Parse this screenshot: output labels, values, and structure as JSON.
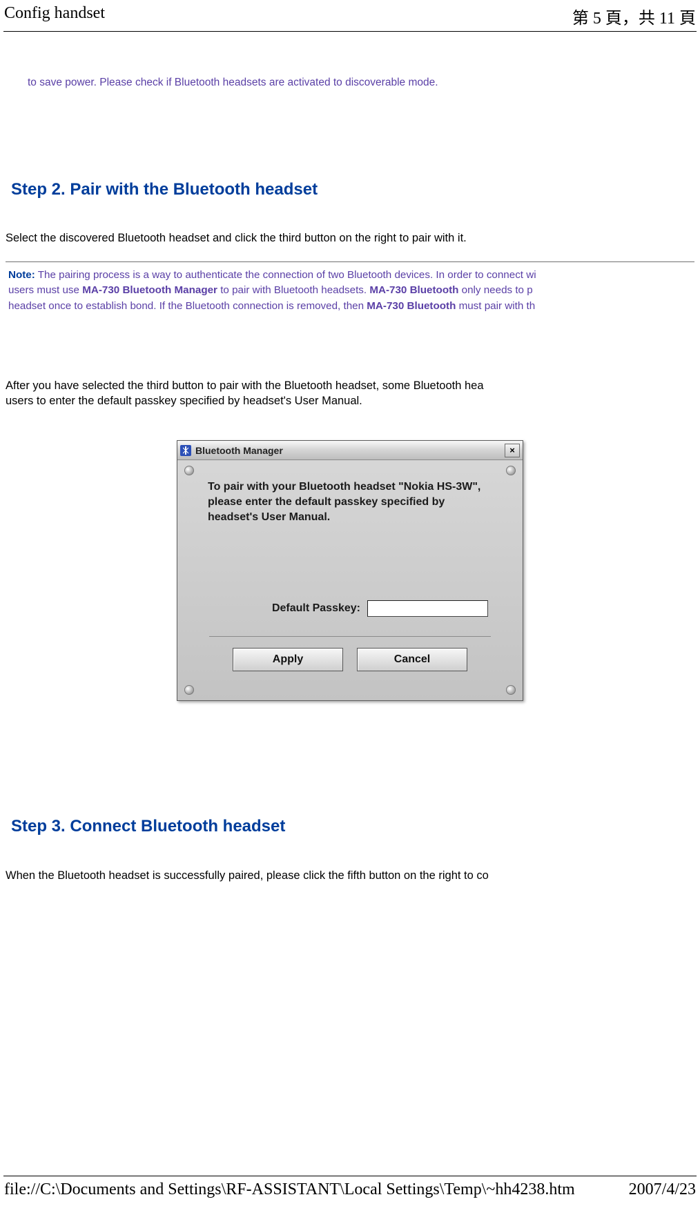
{
  "header": {
    "left": "Config handset",
    "right": "第 5 頁，共 11 頁"
  },
  "fragment_top": "to save power. Please check if Bluetooth headsets are activated to discoverable mode.",
  "step2": {
    "heading": "Step 2. Pair with the Bluetooth headset",
    "para1": "Select the discovered Bluetooth headset and click the third button on the right to pair with it.",
    "note_label": "Note:",
    "note_l1_a": " The pairing process is a way to authenticate the connection of two Bluetooth devices. In order to connect wi",
    "note_l2_a": "users must use ",
    "note_l2_b": "MA-730 Bluetooth Manager",
    "note_l2_c": " to pair with Bluetooth headsets. ",
    "note_l2_d": "MA-730 Bluetooth",
    "note_l2_e": " only needs to p",
    "note_l3_a": "headset once to establish bond. If the Bluetooth connection is removed, then ",
    "note_l3_b": "MA-730 Bluetooth",
    "note_l3_c": " must pair with th",
    "para2": "After you have selected the third button to pair with the Bluetooth headset, some Bluetooth hea\nusers to enter the default passkey specified by headset's User Manual."
  },
  "dialog": {
    "title": "Bluetooth Manager",
    "message": "To pair with your Bluetooth headset \"Nokia HS-3W\", please enter the default passkey specified by headset's User Manual.",
    "passkey_label": "Default Passkey:",
    "passkey_value": "",
    "apply": "Apply",
    "cancel": "Cancel",
    "close": "×"
  },
  "step3": {
    "heading": "Step 3. Connect Bluetooth headset",
    "para1": "When the Bluetooth headset is successfully paired, please click the fifth button on the right to co"
  },
  "footer": {
    "path": "file://C:\\Documents and Settings\\RF-ASSISTANT\\Local Settings\\Temp\\~hh4238.htm",
    "date": "2007/4/23"
  }
}
